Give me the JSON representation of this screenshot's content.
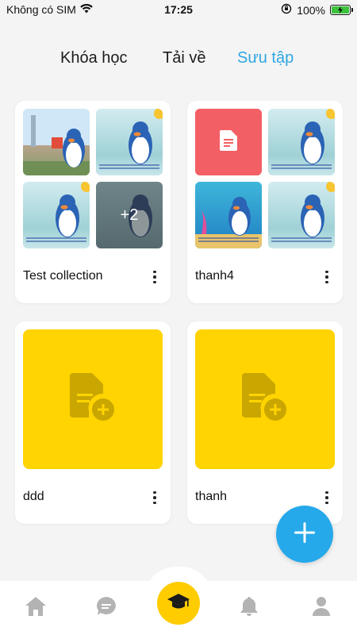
{
  "status_bar": {
    "carrier": "Không có SIM",
    "time": "17:25",
    "battery_percent": "100%"
  },
  "tabs": [
    {
      "label": "Khóa học",
      "active": false
    },
    {
      "label": "Tải về",
      "active": false
    },
    {
      "label": "Sưu tập",
      "active": true
    }
  ],
  "collections": [
    {
      "title": "Test collection",
      "thumbnails": [
        "city-penguin",
        "penguin-sea",
        "penguin-sea",
        "penguin-sea"
      ],
      "extra_count": "+2"
    },
    {
      "title": "thanh4",
      "thumbnails": [
        "document-icon",
        "penguin-sea",
        "penguin-ocean",
        "penguin-sea"
      ]
    },
    {
      "title": "ddd",
      "cover": "add-file-icon"
    },
    {
      "title": "thanh",
      "cover": "add-file-icon"
    }
  ],
  "fab": {
    "icon": "plus-icon"
  },
  "bottom_nav": [
    {
      "icon": "home-icon"
    },
    {
      "icon": "chat-icon"
    },
    {
      "icon": "graduation-cap-icon",
      "active": true
    },
    {
      "icon": "bell-icon"
    },
    {
      "icon": "user-icon"
    }
  ],
  "colors": {
    "accent": "#2ea6e3",
    "cover_yellow": "#ffd400",
    "pdf_red": "#f25f65",
    "nav_center": "#ffcc00"
  }
}
